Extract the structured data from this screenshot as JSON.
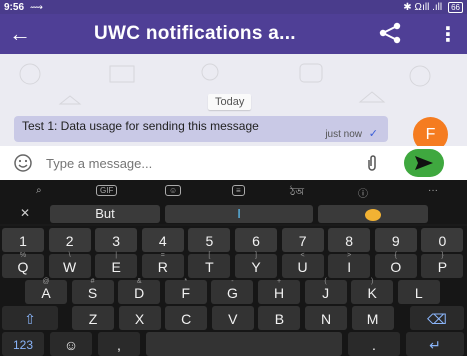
{
  "status_bar": {
    "time": "9:56",
    "signal": "✱ Ωıll .ıll",
    "battery": "66"
  },
  "app_bar": {
    "title": "UWC notifications a..."
  },
  "chat": {
    "date_chip": "Today",
    "message": {
      "text": "Test 1: Data usage for sending this message",
      "time": "just now",
      "status_icon": "double-check-icon"
    },
    "avatar_initial": "F"
  },
  "composer": {
    "placeholder": "Type a message..."
  },
  "keyboard": {
    "suggestions": [
      "But",
      "I",
      ""
    ],
    "number_row": [
      "1",
      "2",
      "3",
      "4",
      "5",
      "6",
      "7",
      "8",
      "9",
      "0"
    ],
    "row1": [
      {
        "k": "Q",
        "h": "%"
      },
      {
        "k": "W",
        "h": "\\"
      },
      {
        "k": "E",
        "h": "|"
      },
      {
        "k": "R",
        "h": "="
      },
      {
        "k": "T",
        "h": "["
      },
      {
        "k": "Y",
        "h": "]"
      },
      {
        "k": "U",
        "h": "<"
      },
      {
        "k": "I",
        "h": ">"
      },
      {
        "k": "O",
        "h": "{"
      },
      {
        "k": "P",
        "h": "}"
      }
    ],
    "row2": [
      {
        "k": "A",
        "h": "@"
      },
      {
        "k": "S",
        "h": "#"
      },
      {
        "k": "D",
        "h": "&"
      },
      {
        "k": "F",
        "h": "*"
      },
      {
        "k": "G",
        "h": "-"
      },
      {
        "k": "H",
        "h": "+"
      },
      {
        "k": "J",
        "h": "("
      },
      {
        "k": "K",
        "h": ")"
      },
      {
        "k": "L",
        "h": ""
      }
    ],
    "row3": [
      {
        "k": "Z",
        "h": ""
      },
      {
        "k": "X",
        "h": ""
      },
      {
        "k": "C",
        "h": ""
      },
      {
        "k": "V",
        "h": ""
      },
      {
        "k": "B",
        "h": ""
      },
      {
        "k": "N",
        "h": ""
      },
      {
        "k": "M",
        "h": ""
      }
    ],
    "bottom": {
      "numeric": "123",
      "comma": ",",
      "period": "."
    },
    "accent_colors": {
      "header": "#4f3f96",
      "send": "#3fa83f",
      "avatar": "#f57c20"
    }
  }
}
